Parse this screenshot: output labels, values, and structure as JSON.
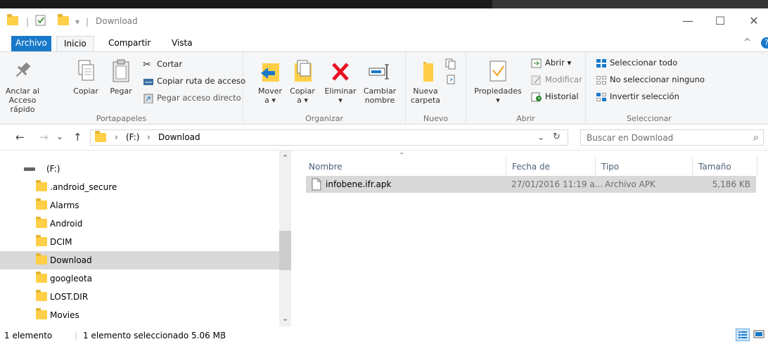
{
  "window": {
    "title": "Download",
    "controls": {
      "minimize": "—",
      "maximize": "☐",
      "close": "✕"
    }
  },
  "ribbon_tabs": [
    {
      "label": "Archivo"
    },
    {
      "label": "Inicio"
    },
    {
      "label": "Compartir"
    },
    {
      "label": "Vista"
    }
  ],
  "ribbon": {
    "portapapeles": {
      "label": "Portapapeles",
      "anclar": [
        "Anclar al",
        "Acceso rápido"
      ],
      "copiar": "Copiar",
      "pegar": "Pegar",
      "cortar": "Cortar",
      "copiar_ruta": "Copiar ruta de acceso",
      "pegar_acceso": "Pegar acceso directo"
    },
    "organizar": {
      "label": "Organizar",
      "mover": [
        "Mover",
        "a ▾"
      ],
      "copiar": [
        "Copiar",
        "a ▾"
      ],
      "eliminar": [
        "Eliminar",
        "▾"
      ],
      "cambiar": [
        "Cambiar",
        "nombre"
      ]
    },
    "nuevo": {
      "label": "Nuevo",
      "nueva_carpeta": [
        "Nueva",
        "carpeta"
      ]
    },
    "abrir": {
      "label": "Abrir",
      "propiedades": [
        "Propiedades",
        "▾"
      ],
      "abrir": "Abrir ▾",
      "modificar": "Modificar",
      "historial": "Historial"
    },
    "seleccionar": {
      "label": "Seleccionar",
      "todo": "Seleccionar todo",
      "ninguno": "No seleccionar ninguno",
      "invertir": "Invertir selección"
    }
  },
  "address": {
    "back": "←",
    "forward": "→",
    "recent": "⌄",
    "up": "↑",
    "crumbs": [
      "(F:)",
      "Download"
    ],
    "separator": "›",
    "dropdown": "⌄",
    "refresh": "↻"
  },
  "search": {
    "placeholder": "Buscar en Download",
    "icon": "⌕"
  },
  "nav_pane": {
    "drive": "(F:)",
    "folders": [
      {
        "label": ".android_secure"
      },
      {
        "label": "Alarms"
      },
      {
        "label": "Android"
      },
      {
        "label": "DCIM"
      },
      {
        "label": "Download"
      },
      {
        "label": "googleota"
      },
      {
        "label": "LOST.DIR"
      },
      {
        "label": "Movies"
      }
    ],
    "scroll_up": "⌃",
    "scroll_down": "⌄"
  },
  "file_list": {
    "sort_arrow": "⌃",
    "columns": {
      "name": "Nombre",
      "date": "Fecha de modifica...",
      "type": "Tipo",
      "size": "Tamaño"
    },
    "rows": [
      {
        "name": "infobene.ifr.apk",
        "date": "27/01/2016 11:19 a...",
        "type": "Archivo APK",
        "size": "5,186 KB"
      }
    ]
  },
  "status": {
    "count": "1 elemento",
    "selection": "1 elemento seleccionado  5.06 MB"
  },
  "colors": {
    "accent": "#1979ca",
    "folder": "#ffcf48",
    "selection": "#d9d9d9",
    "delete": "#e81123"
  }
}
